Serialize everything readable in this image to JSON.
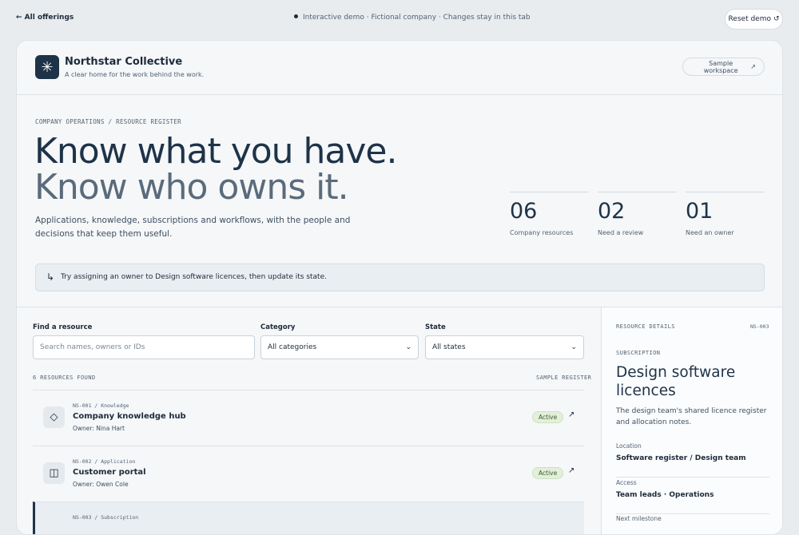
{
  "topbar": {
    "back_label": "← All offerings",
    "demo_note": "Interactive demo · Fictional company · Changes stay in this tab",
    "reset_label": "Reset demo",
    "reset_icon": "↺"
  },
  "brand": {
    "name": "Northstar Collective",
    "tagline": "A clear home for the work behind the work.",
    "logo_glyph": "✳",
    "workspace_label": "Sample workspace",
    "workspace_icon": "↗"
  },
  "hero": {
    "eyebrow": "COMPANY OPERATIONS / RESOURCE REGISTER",
    "line1": "Know what you have.",
    "line2": "Know who owns it.",
    "description": "Applications, knowledge, subscriptions and workflows, with the people and decisions that keep them useful."
  },
  "stats": [
    {
      "value": "06",
      "label": "Company resources"
    },
    {
      "value": "02",
      "label": "Need a review"
    },
    {
      "value": "01",
      "label": "Need an owner"
    }
  ],
  "hint": {
    "arrow": "↳",
    "text": "Try assigning an owner to Design software licences, then update its state."
  },
  "filters": {
    "search_label": "Find a resource",
    "search_placeholder": "Search names, owners or IDs",
    "category_label": "Category",
    "category_value": "All categories",
    "state_label": "State",
    "state_value": "All states",
    "chevron": "⌄"
  },
  "results": {
    "count_label": "6 RESOURCES FOUND",
    "register_label": "SAMPLE REGISTER"
  },
  "resources": [
    {
      "meta": "NS-001 / Knowledge",
      "title": "Company knowledge hub",
      "owner": "Owner: Nina Hart",
      "status": "Active",
      "icon": "◇"
    },
    {
      "meta": "NS-002 / Application",
      "title": "Customer portal",
      "owner": "Owner: Owen Cole",
      "status": "Active",
      "icon": "◫"
    },
    {
      "meta": "NS-003 / Subscription",
      "title": "",
      "owner": "",
      "status": "",
      "icon": ""
    }
  ],
  "details": {
    "heading": "RESOURCE DETAILS",
    "id": "NS-003",
    "category": "SUBSCRIPTION",
    "title": "Design software licences",
    "description": "The design team's shared licence register and allocation notes.",
    "fields": [
      {
        "key": "Location",
        "value": "Software register / Design team"
      },
      {
        "key": "Access",
        "value": "Team leads · Operations"
      },
      {
        "key": "Next milestone",
        "value": ""
      }
    ]
  }
}
